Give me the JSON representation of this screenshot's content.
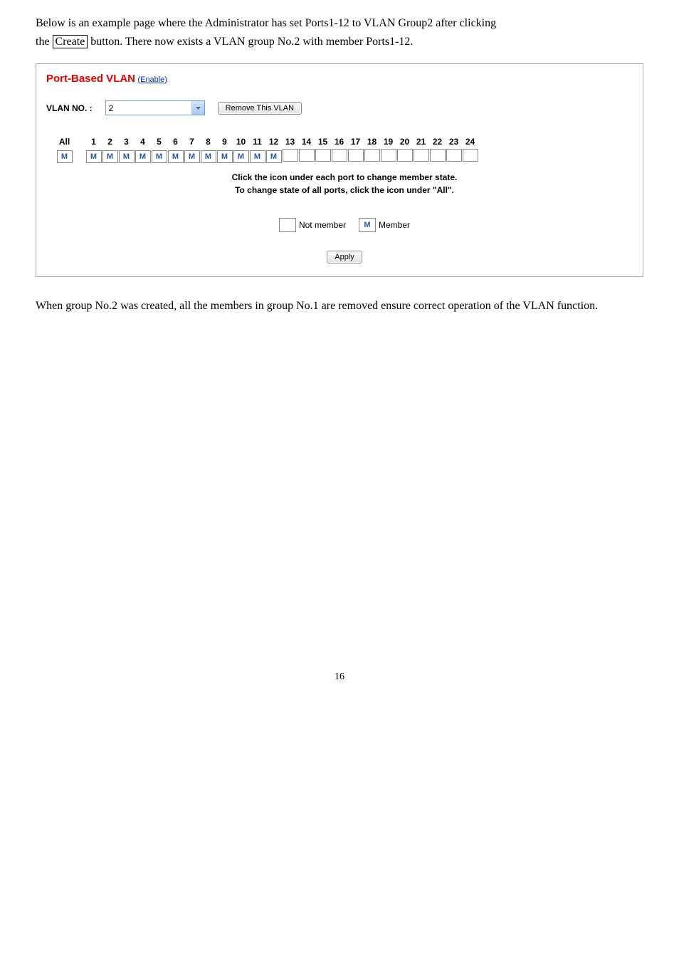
{
  "intro": {
    "line1_a": "Below is an example page where the Administrator has set Ports1-12 to VLAN Group2 after clicking",
    "line2_a": "the ",
    "create_box": "Create",
    "line2_b": " button. There now exists a VLAN group No.2 with member Ports1-12."
  },
  "panel": {
    "title": "Port-Based VLAN",
    "status_link": "(Enable)",
    "vlan_no_label": "VLAN NO. :",
    "vlan_no_value": "2",
    "remove_btn": "Remove This VLAN",
    "headers": [
      "All",
      "1",
      "2",
      "3",
      "4",
      "5",
      "6",
      "7",
      "8",
      "9",
      "10",
      "11",
      "12",
      "13",
      "14",
      "15",
      "16",
      "17",
      "18",
      "19",
      "20",
      "21",
      "22",
      "23",
      "24"
    ],
    "members": [
      true,
      true,
      true,
      true,
      true,
      true,
      true,
      true,
      true,
      true,
      true,
      true,
      true,
      false,
      false,
      false,
      false,
      false,
      false,
      false,
      false,
      false,
      false,
      false,
      false
    ],
    "member_glyph": "M",
    "hint1": "Click the icon under each port to change member state.",
    "hint2": "To change state of all ports, click the icon under \"All\".",
    "legend_not_member": "Not member",
    "legend_member": "Member",
    "apply_btn": "Apply"
  },
  "outro": "When group No.2 was created, all the members in group No.1 are removed ensure correct operation of the VLAN function.",
  "pagenum": "16"
}
